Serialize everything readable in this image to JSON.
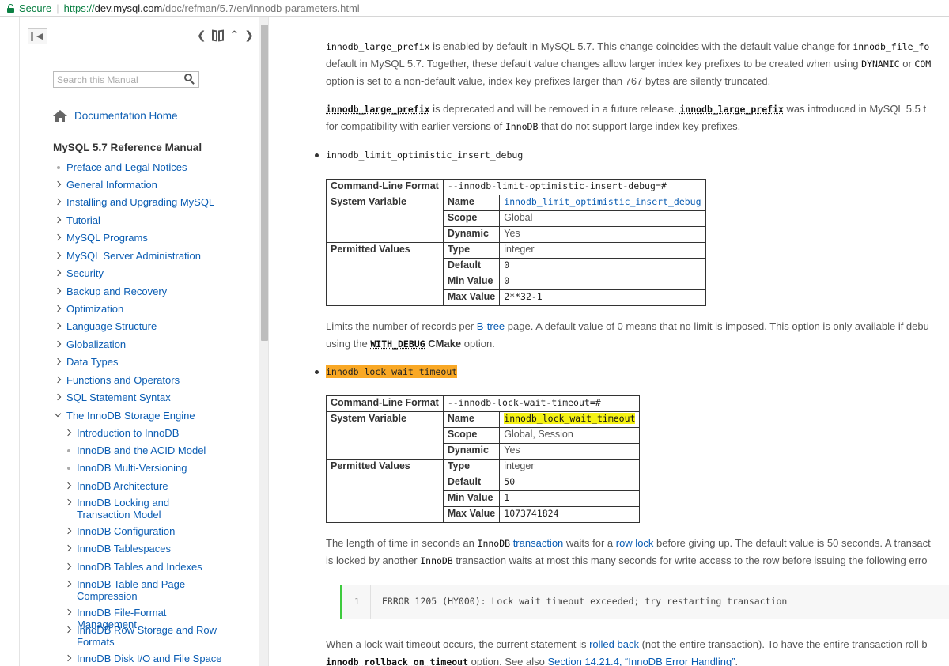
{
  "browser": {
    "secure_label": "Secure",
    "url_scheme": "https://",
    "url_host": "dev.mysql.com",
    "url_path": "/doc/refman/5.7/en/innodb-parameters.html"
  },
  "sidebar": {
    "search_placeholder": "Search this Manual",
    "doc_home": "Documentation Home",
    "manual_title": "MySQL 5.7 Reference Manual",
    "items": [
      {
        "label": "Preface and Legal Notices",
        "marker": "dot"
      },
      {
        "label": "General Information",
        "marker": "chevron"
      },
      {
        "label": "Installing and Upgrading MySQL",
        "marker": "chevron"
      },
      {
        "label": "Tutorial",
        "marker": "chevron"
      },
      {
        "label": "MySQL Programs",
        "marker": "chevron"
      },
      {
        "label": "MySQL Server Administration",
        "marker": "chevron"
      },
      {
        "label": "Security",
        "marker": "chevron"
      },
      {
        "label": "Backup and Recovery",
        "marker": "chevron"
      },
      {
        "label": "Optimization",
        "marker": "chevron"
      },
      {
        "label": "Language Structure",
        "marker": "chevron"
      },
      {
        "label": "Globalization",
        "marker": "chevron"
      },
      {
        "label": "Data Types",
        "marker": "chevron"
      },
      {
        "label": "Functions and Operators",
        "marker": "chevron"
      },
      {
        "label": "SQL Statement Syntax",
        "marker": "chevron"
      },
      {
        "label": "The InnoDB Storage Engine",
        "marker": "chevron-down"
      }
    ],
    "subitems": [
      {
        "label": "Introduction to InnoDB",
        "marker": "chevron"
      },
      {
        "label": "InnoDB and the ACID Model",
        "marker": "dot"
      },
      {
        "label": "InnoDB Multi-Versioning",
        "marker": "dot"
      },
      {
        "label": "InnoDB Architecture",
        "marker": "chevron"
      },
      {
        "label": "InnoDB Locking and Transaction Model",
        "marker": "chevron"
      },
      {
        "label": "InnoDB Configuration",
        "marker": "chevron"
      },
      {
        "label": "InnoDB Tablespaces",
        "marker": "chevron"
      },
      {
        "label": "InnoDB Tables and Indexes",
        "marker": "chevron"
      },
      {
        "label": "InnoDB Table and Page Compression",
        "marker": "chevron"
      },
      {
        "label": "InnoDB File-Format Management",
        "marker": "chevron"
      },
      {
        "label": "InnoDB Row Storage and Row Formats",
        "marker": "chevron"
      },
      {
        "label": "InnoDB Disk I/O and File Space",
        "marker": "chevron"
      }
    ]
  },
  "content": {
    "p1": {
      "code1": "innodb_large_prefix",
      "t1": " is enabled by default in MySQL 5.7. This change coincides with the default value change for ",
      "code2": "innodb_file_fo",
      "line2a": "default in MySQL 5.7. Together, these default value changes allow larger index key prefixes to be created when using ",
      "code3": "DYNAMIC",
      "line2b": " or ",
      "code4": "COM",
      "line3": "option is set to a non-default value, index key prefixes larger than 767 bytes are silently truncated."
    },
    "p2": {
      "code1": "innodb_large_prefix",
      "t1": " is deprecated and will be removed in a future release. ",
      "code2": "innodb_large_prefix",
      "t2": " was introduced in MySQL 5.5 t",
      "line2a": "for compatibility with earlier versions of ",
      "code3": "InnoDB",
      "line2b": " that do not support large index key prefixes."
    },
    "param1": {
      "name": "innodb_limit_optimistic_insert_debug",
      "cmd_label": "Command-Line Format",
      "cmd_value": "--innodb-limit-optimistic-insert-debug=#",
      "sysvar_label": "System Variable",
      "name_label": "Name",
      "name_value": "innodb_limit_optimistic_insert_debug",
      "scope_label": "Scope",
      "scope_value": "Global",
      "dynamic_label": "Dynamic",
      "dynamic_value": "Yes",
      "perm_label": "Permitted Values",
      "type_label": "Type",
      "type_value": "integer",
      "default_label": "Default",
      "default_value": "0",
      "min_label": "Min Value",
      "min_value": "0",
      "max_label": "Max Value",
      "max_value": "2**32-1"
    },
    "p3": {
      "t1": "Limits the number of records per ",
      "link1": "B-tree",
      "t2": " page. A default value of 0 means that no limit is imposed. This option is only available if debu",
      "line2a": "using the ",
      "code1": "WITH_DEBUG",
      "b1": "CMake",
      "line2b": " option."
    },
    "param2": {
      "name": "innodb_lock_wait_timeout",
      "cmd_label": "Command-Line Format",
      "cmd_value": "--innodb-lock-wait-timeout=#",
      "sysvar_label": "System Variable",
      "name_label": "Name",
      "name_value": "innodb_lock_wait_timeout",
      "scope_label": "Scope",
      "scope_value": "Global, Session",
      "dynamic_label": "Dynamic",
      "dynamic_value": "Yes",
      "perm_label": "Permitted Values",
      "type_label": "Type",
      "type_value": "integer",
      "default_label": "Default",
      "default_value": "50",
      "min_label": "Min Value",
      "min_value": "1",
      "max_label": "Max Value",
      "max_value": "1073741824"
    },
    "p4": {
      "t1": "The length of time in seconds an ",
      "code1": "InnoDB",
      "sp1": " ",
      "link1": "transaction",
      "t2": " waits for a ",
      "link2": "row lock",
      "t3": " before giving up. The default value is 50 seconds. A transact",
      "line2a": "is locked by another ",
      "code2": "InnoDB",
      "line2b": " transaction waits at most this many seconds for write access to the row before issuing the following erro"
    },
    "codeblock": {
      "line_no": "1",
      "code": "ERROR 1205 (HY000): Lock wait timeout exceeded; try restarting transaction"
    },
    "p5": {
      "t1": "When a lock wait timeout occurs, the current statement is ",
      "link1": "rolled back",
      "t2": " (not the entire transaction). To have the entire transaction roll b",
      "code1": "innodb_rollback_on_timeout",
      "t3": " option. See also ",
      "link2": "Section 14.21.4, “InnoDB Error Handling”",
      "t4": "."
    }
  },
  "colors": {
    "link": "#0b5db3",
    "highlight_orange": "#f9a825",
    "highlight_yellow": "#f5f214",
    "code_bar": "#3ecb3e"
  }
}
